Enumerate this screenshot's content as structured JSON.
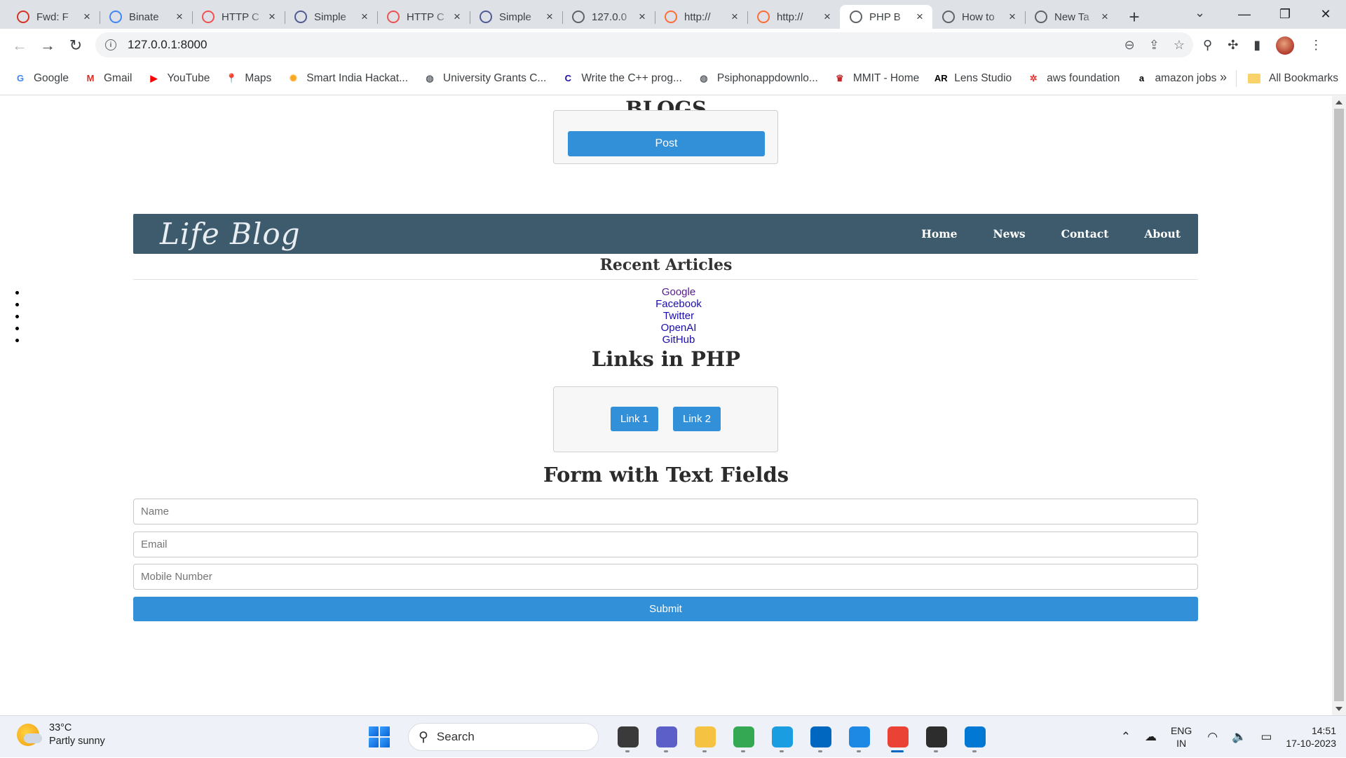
{
  "browser": {
    "tabs": [
      {
        "title": "Fwd: F",
        "favicon": "gmail-icon",
        "color": "#d93025"
      },
      {
        "title": "Binate",
        "favicon": "docs-icon",
        "color": "#4285f4"
      },
      {
        "title": "HTTP C",
        "favicon": "laravel-icon",
        "color": "#ef5350"
      },
      {
        "title": "Simple",
        "favicon": "php-icon",
        "color": "#4f5b93"
      },
      {
        "title": "HTTP C",
        "favicon": "laravel-icon",
        "color": "#ef5350"
      },
      {
        "title": "Simple",
        "favicon": "php-icon",
        "color": "#4f5b93"
      },
      {
        "title": "127.0.0",
        "favicon": "globe-icon",
        "color": "#5f6368"
      },
      {
        "title": "http://",
        "favicon": "postman-icon",
        "color": "#ff6c37"
      },
      {
        "title": "http://",
        "favicon": "postman-icon",
        "color": "#ff6c37"
      },
      {
        "title": "PHP B",
        "favicon": "globe-icon",
        "color": "#5f6368",
        "active": true
      },
      {
        "title": "How to",
        "favicon": "globe-icon",
        "color": "#5f6368"
      },
      {
        "title": "New Ta",
        "favicon": "chrome-icon",
        "color": "#5f6368"
      }
    ],
    "url": "127.0.0.1:8000",
    "bookmarks": [
      {
        "label": "Google",
        "icon": "google-icon",
        "glyph": "G",
        "color": "#4285f4"
      },
      {
        "label": "Gmail",
        "icon": "gmail-icon",
        "glyph": "M",
        "color": "#d93025"
      },
      {
        "label": "YouTube",
        "icon": "youtube-icon",
        "glyph": "▶",
        "color": "#ff0000"
      },
      {
        "label": "Maps",
        "icon": "maps-icon",
        "glyph": "📍",
        "color": "#34a853"
      },
      {
        "label": "Smart India Hackat...",
        "icon": "sih-icon",
        "glyph": "✺",
        "color": "#f9a825"
      },
      {
        "label": "University Grants C...",
        "icon": "globe-icon",
        "glyph": "◍",
        "color": "#5f6368"
      },
      {
        "label": "Write the C++ prog...",
        "icon": "codechef-icon",
        "glyph": "C",
        "color": "#1a0dab"
      },
      {
        "label": "Psiphonappdownlo...",
        "icon": "globe-icon",
        "glyph": "◍",
        "color": "#5f6368"
      },
      {
        "label": "MMIT - Home",
        "icon": "mmit-icon",
        "glyph": "♛",
        "color": "#c62828"
      },
      {
        "label": "Lens Studio",
        "icon": "ar-icon",
        "glyph": "AR",
        "color": "#000000"
      },
      {
        "label": "aws foundation",
        "icon": "aws-icon",
        "glyph": "✲",
        "color": "#e53935"
      },
      {
        "label": "amazon jobs",
        "icon": "amazon-icon",
        "glyph": "a",
        "color": "#000000"
      }
    ],
    "bookmarks_more": "»",
    "all_bookmarks": "All Bookmarks"
  },
  "page": {
    "blogs_heading": "BLOGS",
    "post_button": "Post",
    "logo": "Life Blog",
    "nav": [
      "Home",
      "News",
      "Contact",
      "About"
    ],
    "recent_heading": "Recent Articles",
    "articles": [
      "Google",
      "Facebook",
      "Twitter",
      "OpenAI",
      "GitHub"
    ],
    "links_heading": "Links in PHP",
    "link_buttons": [
      "Link 1",
      "Link 2"
    ],
    "form_heading": "Form with Text Fields",
    "fields": [
      {
        "placeholder": "Name",
        "value": ""
      },
      {
        "placeholder": "Email",
        "value": ""
      },
      {
        "placeholder": "Mobile Number",
        "value": ""
      }
    ],
    "submit_button": "Submit",
    "accent_color": "#3290d9",
    "navbar_color": "#3e5b6d"
  },
  "taskbar": {
    "weather_temp": "33°C",
    "weather_desc": "Partly sunny",
    "search_label": "Search",
    "apps": [
      {
        "name": "task-view-icon",
        "color": "#3a3a3a"
      },
      {
        "name": "chat-icon",
        "color": "#5b5fc7"
      },
      {
        "name": "file-explorer-icon",
        "color": "#f5c242"
      },
      {
        "name": "chrome-icon",
        "color": "#34a853"
      },
      {
        "name": "edge-icon",
        "color": "#1b9de2"
      },
      {
        "name": "store-icon",
        "color": "#0067c0"
      },
      {
        "name": "notepad-icon",
        "color": "#1e88e5"
      },
      {
        "name": "chrome-profile-icon",
        "color": "#ea4335",
        "active": true
      },
      {
        "name": "terminal-icon",
        "color": "#2d2d2d"
      },
      {
        "name": "vscode-icon",
        "color": "#0078d4"
      }
    ],
    "language": "ENG",
    "region": "IN",
    "time": "14:51",
    "date": "17-10-2023"
  }
}
